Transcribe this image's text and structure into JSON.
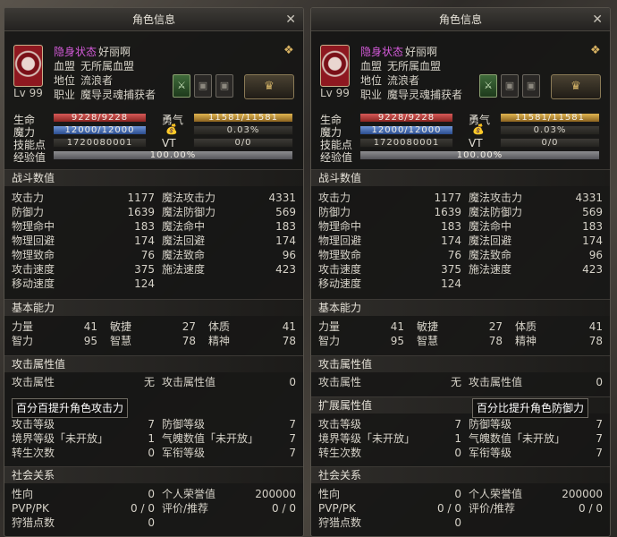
{
  "window_title": "角色信息",
  "close_glyph": "✕",
  "profile": {
    "stealth_label": "隐身状态",
    "name": "好丽啊",
    "clan_label": "血盟",
    "clan_value": "无所属血盟",
    "rank_label": "地位",
    "rank_value": "流浪者",
    "level": "Lv 99",
    "class_label": "职业",
    "class_value": "魔导灵魂捕获者"
  },
  "resources": {
    "hp_label": "生命",
    "hp": "9228/9228",
    "mp_label": "魔力",
    "mp": "12000/12000",
    "sp_label": "技能点",
    "sp": "1720080001",
    "exp_label": "经验值",
    "exp": "100.00%",
    "exp_percent": 100,
    "courage_label": "勇气",
    "courage": "11581/11581",
    "pouch_value": "0.03%",
    "vt_label": "VT",
    "vt": "0/0"
  },
  "combat": {
    "title": "战斗数值",
    "left": [
      {
        "k": "攻击力",
        "v": "1177"
      },
      {
        "k": "防御力",
        "v": "1639"
      },
      {
        "k": "物理命中",
        "v": "183"
      },
      {
        "k": "物理回避",
        "v": "174"
      },
      {
        "k": "物理致命",
        "v": "76"
      },
      {
        "k": "攻击速度",
        "v": "375"
      },
      {
        "k": "移动速度",
        "v": "124"
      }
    ],
    "right": [
      {
        "k": "魔法攻击力",
        "v": "4331"
      },
      {
        "k": "魔法防御力",
        "v": "569"
      },
      {
        "k": "魔法命中",
        "v": "183"
      },
      {
        "k": "魔法回避",
        "v": "174"
      },
      {
        "k": "魔法致命",
        "v": "96"
      },
      {
        "k": "施法速度",
        "v": "423"
      }
    ]
  },
  "basic": {
    "title": "基本能力",
    "items": [
      {
        "k": "力量",
        "v": "41"
      },
      {
        "k": "敏捷",
        "v": "27"
      },
      {
        "k": "体质",
        "v": "41"
      },
      {
        "k": "智力",
        "v": "95"
      },
      {
        "k": "智慧",
        "v": "78"
      },
      {
        "k": "精神",
        "v": "78"
      }
    ]
  },
  "attack_attr": {
    "title": "攻击属性值",
    "k1": "攻击属性",
    "v1": "无",
    "k2": "攻击属性值",
    "v2": "0"
  },
  "ext_attr": {
    "title": "扩展属性值"
  },
  "tooltips": {
    "left": "百分百提升角色攻击力",
    "right": "百分比提升角色防御力"
  },
  "levels": {
    "left": [
      {
        "k": "攻击等级",
        "v": "7"
      },
      {
        "k": "境界等级「未开放」",
        "v": "1"
      },
      {
        "k": "转生次数",
        "v": "0"
      }
    ],
    "right": [
      {
        "k": "防御等级",
        "v": "7"
      },
      {
        "k": "气魄数值「未开放」",
        "v": "7"
      },
      {
        "k": "军衔等级",
        "v": "7"
      }
    ]
  },
  "social": {
    "title": "社会关系",
    "left": [
      {
        "k": "性向",
        "v": "0"
      },
      {
        "k": "PVP/PK",
        "v": "0 / 0"
      },
      {
        "k": "狩猎点数",
        "v": "0"
      }
    ],
    "right": [
      {
        "k": "个人荣誉值",
        "v": "200000"
      },
      {
        "k": "评价/推荐",
        "v": "0 / 0"
      }
    ]
  }
}
